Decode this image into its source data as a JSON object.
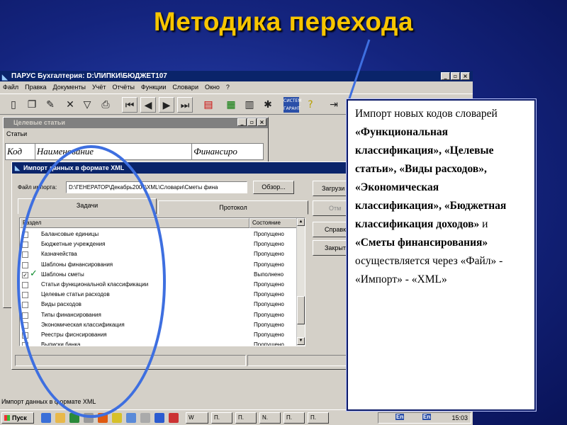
{
  "slide": {
    "title": "Методика перехода",
    "accent_color": "#f7c500",
    "highlight_color": "#3e6fe0"
  },
  "app": {
    "title": "ПАРУС Бухгалтерия: D:\\ЛИПКИ\\БЮДЖЕТ107",
    "menu": [
      "Файл",
      "Правка",
      "Документы",
      "Учёт",
      "Отчёты",
      "Функции",
      "Словари",
      "Окно",
      "?"
    ],
    "toolbar_icons": [
      "new-icon",
      "copy-icon",
      "edit-icon",
      "delete-icon",
      "filter-icon",
      "print-icon",
      "first-icon",
      "prev-icon",
      "next-icon",
      "last-icon",
      "list-icon",
      "calculator-icon",
      "table-icon",
      "tools-icon",
      "system-garant-icon",
      "help-icon",
      "exit-icon"
    ]
  },
  "child_window": {
    "title": "Целевые статьи",
    "subtitle": "Статьи",
    "columns": [
      "Код",
      "Наименование",
      "Финансиро"
    ]
  },
  "dialog": {
    "title": "Импорт данных в формате XML",
    "file_label": "Файл импорта:",
    "file_value": "D:\\ГЕНЕРАТОР\\Декабрь2004\\XML\\Словари\\Сметы фина",
    "browse_label": "Обзор...",
    "tabs": [
      "Задачи",
      "Протокол"
    ],
    "columns": [
      "Раздел",
      "Состояние"
    ],
    "rows": [
      {
        "name": "Балансовые единицы",
        "state": "Пропущено",
        "checked": false
      },
      {
        "name": "Бюджетные учреждения",
        "state": "Пропущено",
        "checked": false
      },
      {
        "name": "Казначейства",
        "state": "Пропущено",
        "checked": false
      },
      {
        "name": "Шаблоны финансирования",
        "state": "Пропущено",
        "checked": false
      },
      {
        "name": "Шаблоны сметы",
        "state": "Выполнено",
        "checked": true
      },
      {
        "name": "Статьи функциональной классификации",
        "state": "Пропущено",
        "checked": false
      },
      {
        "name": "Целевые статьи расходов",
        "state": "Пропущено",
        "checked": false
      },
      {
        "name": "Виды расходов",
        "state": "Пропущено",
        "checked": false
      },
      {
        "name": "Типы финансирования",
        "state": "Пропущено",
        "checked": false
      },
      {
        "name": "Экономическая классификация",
        "state": "Пропущено",
        "checked": false
      },
      {
        "name": "Реестры фиснсирования",
        "state": "Пропущено",
        "checked": false
      },
      {
        "name": "Выписки банка",
        "state": "Пропущено",
        "checked": false
      }
    ],
    "buttons": {
      "load": "Загрузи",
      "cancel": "Отм",
      "help": "Справк",
      "close": "Закрыт"
    }
  },
  "status_text": "Импорт данных в формате XML",
  "taskbar": {
    "start": "Пуск",
    "buttons": [
      "W",
      "П.",
      "П.",
      "N.",
      "П.",
      "П."
    ],
    "clock": "15:03",
    "tray_labels": [
      "En",
      "En"
    ]
  },
  "callout": {
    "parts": [
      {
        "text": "Импорт новых кодов словарей ",
        "bold": false
      },
      {
        "text": "«Функциональная классификация», «Целевые статьи», «Виды расходов», «Экономическая классификация», «Бюджетная классификация доходов»",
        "bold": true
      },
      {
        "text": "  и ",
        "bold": false
      },
      {
        "text": "«Сметы финансирования»",
        "bold": true
      },
      {
        "text": " осуществляется через «Файл» - «Импорт» - «XML»",
        "bold": false
      }
    ]
  }
}
